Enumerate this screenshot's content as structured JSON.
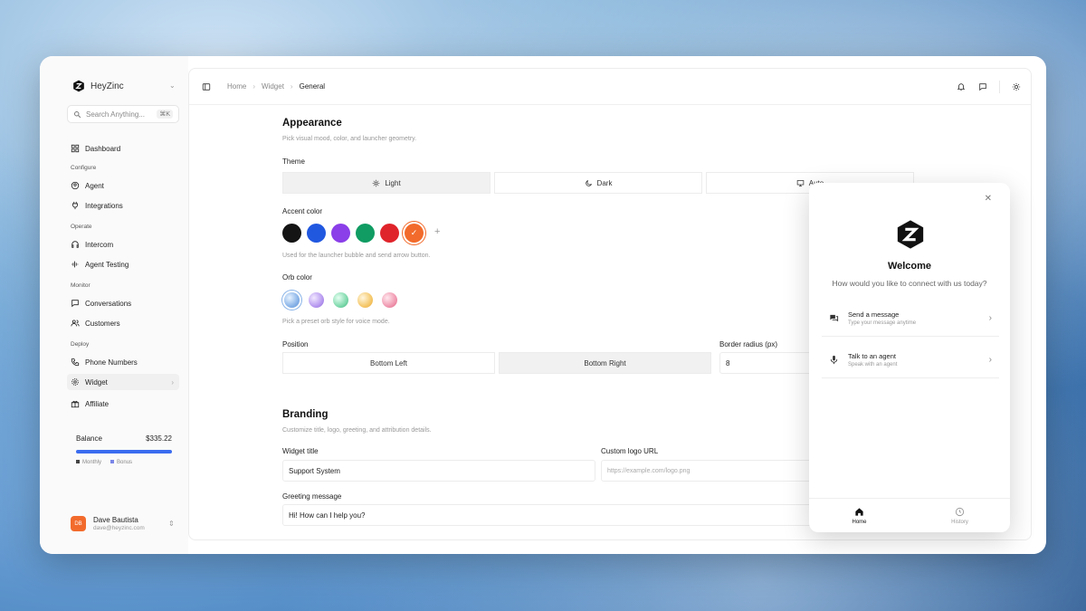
{
  "sidebar": {
    "brand": "HeyZinc",
    "search_placeholder": "Search Anything...",
    "search_shortcut": "⌘K",
    "items": [
      {
        "label": "Dashboard"
      },
      {
        "section": "Configure"
      },
      {
        "label": "Agent"
      },
      {
        "label": "Integrations"
      },
      {
        "section": "Operate"
      },
      {
        "label": "Intercom"
      },
      {
        "label": "Agent Testing"
      },
      {
        "section": "Monitor"
      },
      {
        "label": "Conversations"
      },
      {
        "label": "Customers"
      },
      {
        "section": "Deploy"
      },
      {
        "label": "Phone Numbers"
      },
      {
        "label": "Widget"
      },
      {
        "label": "Affiliate"
      }
    ],
    "balance": {
      "label": "Balance",
      "amount": "$335.22",
      "legend_monthly": "Monthly",
      "legend_bonus": "Bonus",
      "accent": "#3b6cf0"
    },
    "user": {
      "initials": "DB",
      "name": "Dave Bautista",
      "email": "dave@heyzinc.com"
    }
  },
  "breadcrumb": [
    "Home",
    "Widget",
    "General"
  ],
  "appearance": {
    "title": "Appearance",
    "subtitle": "Pick visual mood, color, and launcher geometry.",
    "theme_label": "Theme",
    "themes": [
      "Light",
      "Dark",
      "Auto"
    ],
    "selected_theme": "Light",
    "accent_label": "Accent color",
    "accent_colors": [
      "#141414",
      "#2158e0",
      "#8a3fe8",
      "#109c63",
      "#e0242b",
      "#f26b2c"
    ],
    "selected_accent": "#f26b2c",
    "accent_help": "Used for the launcher bubble and send arrow button.",
    "orb_label": "Orb color",
    "orb_help": "Pick a preset orb style for voice mode.",
    "position_label": "Position",
    "positions": [
      "Bottom Left",
      "Bottom Right"
    ],
    "selected_position": "Bottom Right",
    "radius_label": "Border radius (px)",
    "radius_value": "8"
  },
  "branding": {
    "title": "Branding",
    "subtitle": "Customize title, logo, greeting, and attribution details.",
    "widget_title_label": "Widget title",
    "widget_title_value": "Support System",
    "logo_url_label": "Custom logo URL",
    "logo_url_placeholder": "https://example.com/logo.png",
    "greeting_label": "Greeting message",
    "greeting_value": "Hi! How can I help you?"
  },
  "widget_preview": {
    "title": "Welcome",
    "subtitle": "How would you like to connect with us today?",
    "options": [
      {
        "title": "Send a message",
        "subtitle": "Type your message anytime"
      },
      {
        "title": "Talk to an agent",
        "subtitle": "Speak with an agent"
      }
    ],
    "tabs": [
      "Home",
      "History"
    ],
    "active_tab": "Home"
  }
}
